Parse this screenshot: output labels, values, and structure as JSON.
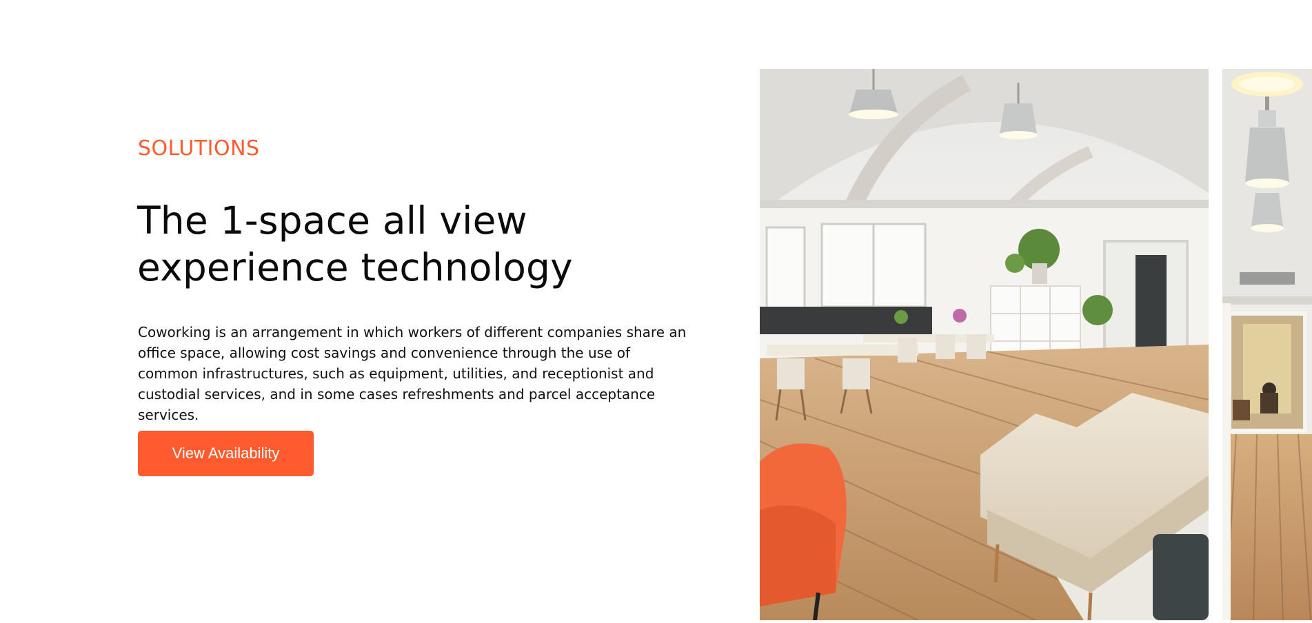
{
  "section": {
    "eyebrow": "SOLUTIONS",
    "headline_line1": "The 1-space all view",
    "headline_line2": "experience technology",
    "description": "Coworking is an arrangement in which workers of different companies share an office space, allowing cost savings and convenience through the use of common infrastructures, such as equipment, utilities, and receptionist and custodial services, and in some cases refreshments and parcel acceptance services.",
    "cta_label": "View Availability"
  },
  "gallery": [
    {
      "label": "Coworking open-plan office photo"
    },
    {
      "label": "Coworking corridor photo"
    }
  ],
  "colors": {
    "accent": "#ff5b2e",
    "text": "#0b0b0b",
    "background": "#ffffff"
  }
}
